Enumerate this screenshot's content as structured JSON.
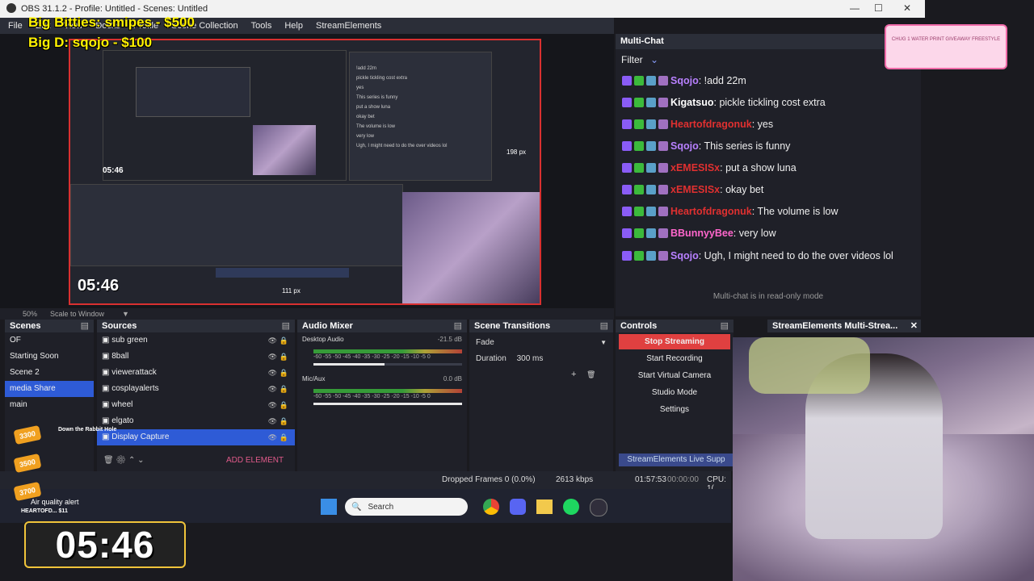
{
  "window": {
    "title": "OBS 31.1.2 - Profile: Untitled - Scenes: Untitled",
    "min": "—",
    "max": "☐",
    "close": "✕"
  },
  "menu": [
    "File",
    "Edit",
    "View",
    "Docks",
    "Profile",
    "Scene Collection",
    "Tools",
    "Help",
    "StreamElements"
  ],
  "overlays": {
    "line1": "Big Bitties: smipes - $500",
    "line2": "Big D: sqojo - $100",
    "timer_small": "05:46",
    "timer_big": "05:46",
    "px_right": "198 px",
    "px_bottom": "111 px",
    "gift": "CHUG 1 WATER PRINT GIVEAWAY FREESTYLE",
    "goals": [
      {
        "value": "3300",
        "label": "Down the Rabbit Hole"
      },
      {
        "value": "3500",
        "label": ""
      },
      {
        "value": "3700",
        "label": ""
      }
    ],
    "alert": "Air quality alert",
    "tip": "HEARTOFD... $11"
  },
  "preview_status": {
    "zoom": "50%",
    "scale": "Scale to Window"
  },
  "multichat": {
    "title": "Multi-Chat",
    "filter": "Filter",
    "readonly": "Multi-chat is in read-only mode",
    "messages": [
      {
        "user": "Sqojo",
        "color": "#b880ff",
        "text": "!add 22m"
      },
      {
        "user": "Kigatsuo",
        "color": "#ffffff",
        "text": "pickle tickling cost extra"
      },
      {
        "user": "Heartofdragonuk",
        "color": "#e03030",
        "text": "yes"
      },
      {
        "user": "Sqojo",
        "color": "#b880ff",
        "text": "This series is funny"
      },
      {
        "user": "xEMESISx",
        "color": "#e03030",
        "text": "put a show luna"
      },
      {
        "user": "xEMESISx",
        "color": "#e03030",
        "text": "okay bet"
      },
      {
        "user": "Heartofdragonuk",
        "color": "#e03030",
        "text": "The volume is low"
      },
      {
        "user": "BBunnyyBee",
        "color": "#ff66cc",
        "text": "very low"
      },
      {
        "user": "Sqojo",
        "color": "#b880ff",
        "text": "Ugh, I might need to do the over videos lol"
      }
    ]
  },
  "scenes": {
    "title": "Scenes",
    "items": [
      "OF",
      "Starting Soon",
      "Scene 2",
      "media Share",
      "main"
    ],
    "selected": 3
  },
  "sources": {
    "title": "Sources",
    "items": [
      "sub green",
      "8ball",
      "viewerattack",
      "cosplayalerts",
      "wheel",
      "elgato",
      "Display Capture"
    ],
    "add": "ADD ELEMENT"
  },
  "audio": {
    "title": "Audio Mixer",
    "tracks": [
      {
        "name": "Desktop Audio",
        "db": "-21.5 dB"
      },
      {
        "name": "Mic/Aux",
        "db": "0.0 dB"
      }
    ],
    "scale": "-60 -55 -50 -45 -40 -35 -30 -25 -20 -15 -10 -5 0"
  },
  "transitions": {
    "title": "Scene Transitions",
    "type": "Fade",
    "duration_label": "Duration",
    "duration": "300 ms"
  },
  "controls": {
    "title": "Controls",
    "buttons": [
      "Stop Streaming",
      "Start Recording",
      "Start Virtual Camera",
      "Studio Mode",
      "Settings"
    ]
  },
  "se": {
    "title": "StreamElements Multi-Strea...",
    "live": "StreamElements Live Supp"
  },
  "status": {
    "dropped": "Dropped Frames 0 (0.0%)",
    "kbps": "2613 kbps",
    "live_time": "01:57:53",
    "rec_time": "00:00:00",
    "cpu": "CPU: 1("
  },
  "taskbar": {
    "search": "Search"
  }
}
